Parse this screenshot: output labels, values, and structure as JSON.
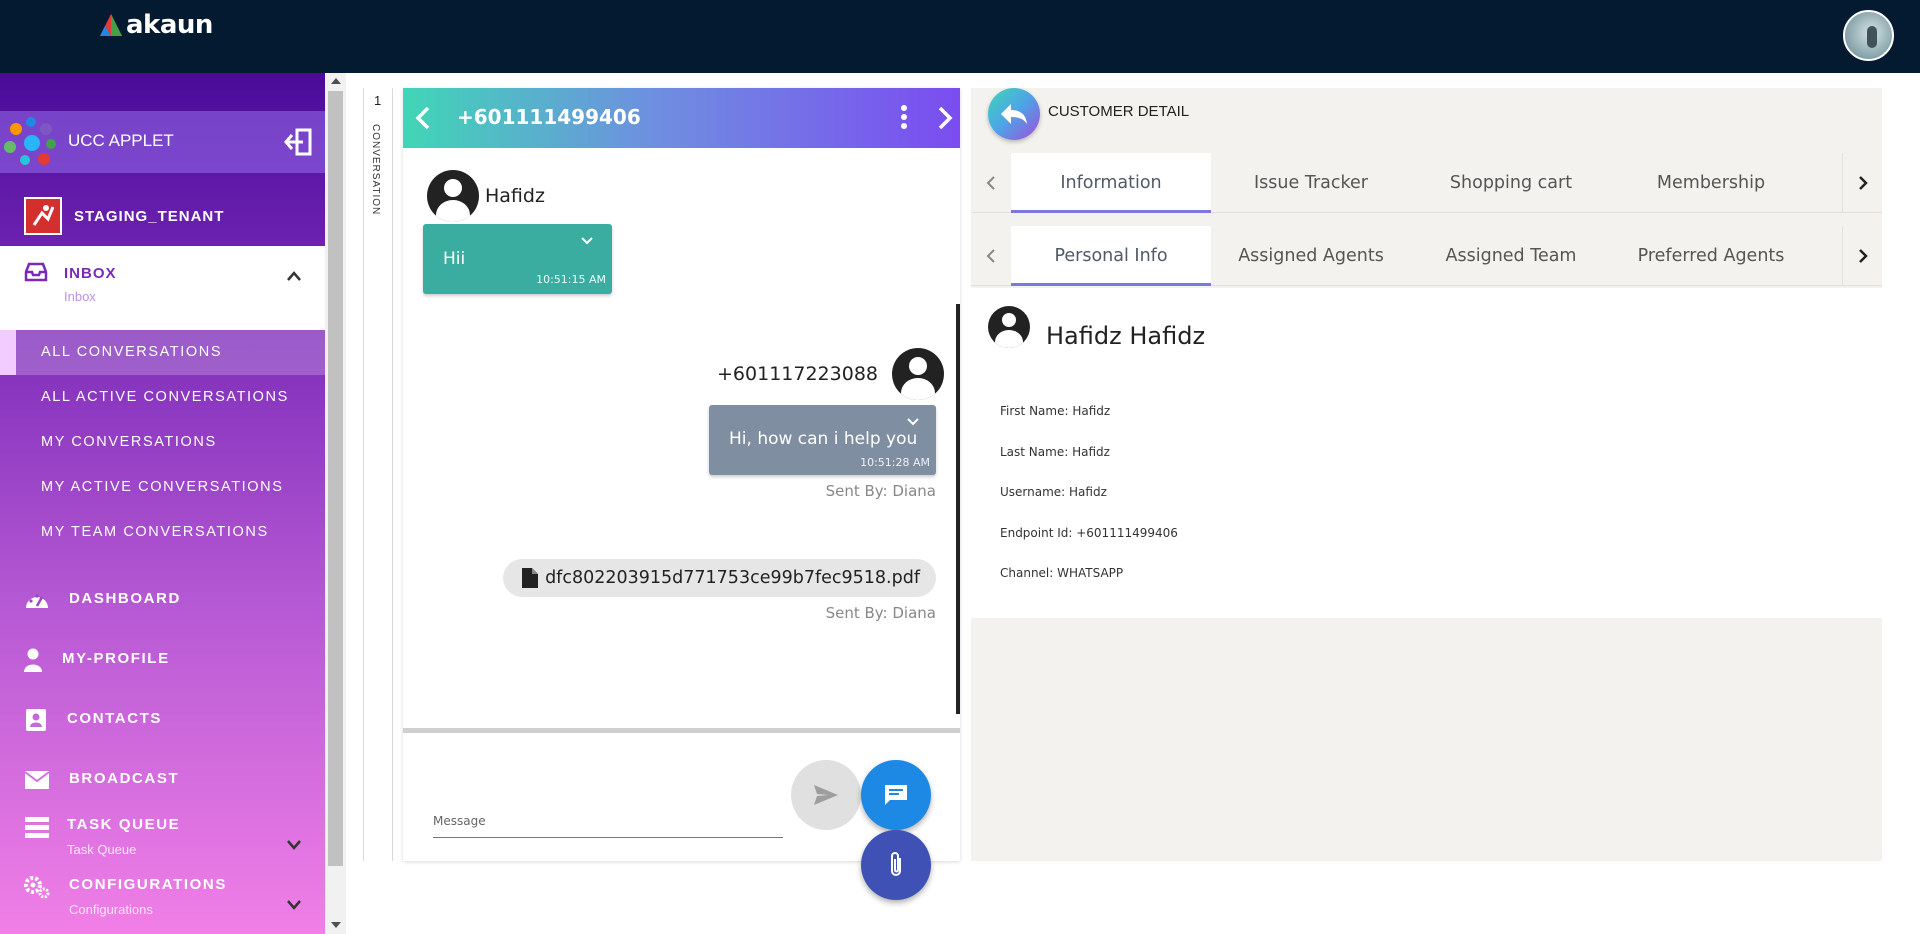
{
  "app": {
    "logo_text": "akaun"
  },
  "sidebar": {
    "applet_title": "UCC APPLET",
    "tenant_name": "STAGING_TENANT",
    "inbox": {
      "label": "INBOX",
      "sub": "Inbox"
    },
    "conversations": [
      "ALL CONVERSATIONS",
      "ALL ACTIVE CONVERSATIONS",
      "MY CONVERSATIONS",
      "MY ACTIVE CONVERSATIONS",
      "MY TEAM CONVERSATIONS"
    ],
    "nav": {
      "dashboard": "DASHBOARD",
      "my_profile": "MY-PROFILE",
      "contacts": "CONTACTS",
      "broadcast": "BROADCAST",
      "task_queue": {
        "label": "TASK QUEUE",
        "sub": "Task Queue"
      },
      "configurations": {
        "label": "CONFIGURATIONS",
        "sub": "Configurations"
      }
    }
  },
  "tabstrip": {
    "count": "1",
    "label": "CONVERSATION"
  },
  "chat": {
    "header_title": "+601111499406",
    "incoming": {
      "sender": "Hafidz",
      "text": "Hii",
      "time": "10:51:15 AM"
    },
    "outgoing": {
      "sender": "+601117223088",
      "text": "Hi, how can i help you",
      "time": "10:51:28 AM",
      "sent_by": "Sent By: Diana"
    },
    "file": {
      "name": "dfc802203915d771753ce99b7fec9518.pdf",
      "sent_by": "Sent By: Diana"
    },
    "composer": {
      "placeholder": "Message"
    }
  },
  "detail": {
    "title": "CUSTOMER DETAIL",
    "tabs_main": [
      "Information",
      "Issue Tracker",
      "Shopping cart",
      "Membership"
    ],
    "tabs_sub": [
      "Personal Info",
      "Assigned Agents",
      "Assigned Team",
      "Preferred Agents"
    ],
    "customer_name": "Hafidz Hafidz",
    "fields": [
      "First Name: Hafidz",
      "Last Name: Hafidz",
      "Username: Hafidz",
      "Endpoint Id: +601111499406",
      "Channel: WHATSAPP"
    ]
  },
  "colors": {
    "topbar": "#031a31",
    "incoming_bubble": "#3aada0",
    "outgoing_bubble": "#7f8ea0",
    "fab_chat": "#1e88e5",
    "fab_attach": "#3f51b5"
  },
  "icons": [
    "logout-icon",
    "inbox-icon",
    "dashboard-icon",
    "person-icon",
    "contacts-icon",
    "mail-icon",
    "queue-icon",
    "gears-icon",
    "send-icon",
    "chat-icon",
    "paperclip-icon",
    "file-icon",
    "back-arrow-icon",
    "more-vert-icon"
  ]
}
